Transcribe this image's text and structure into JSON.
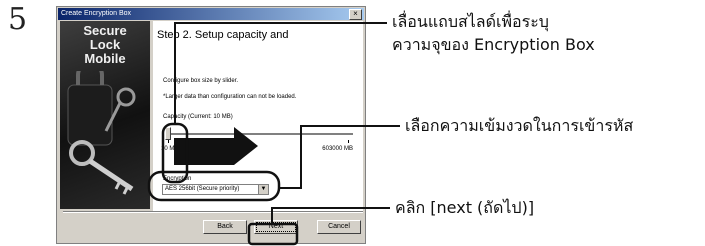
{
  "step_number": "5",
  "dialog": {
    "title": "Create Encryption Box",
    "close_glyph": "×",
    "brand": "Secure Lock Mobile",
    "brand_lines": [
      "Secure",
      "Lock",
      "Mobile"
    ],
    "step_title": "Step 2. Setup capacity and",
    "configure_text": "Configure box size by slider.",
    "warning_text": "*Larger data than configuration can not be loaded.",
    "capacity_label": "Capacity (Current: 10 MB)",
    "slider": {
      "min_label": "10 MB",
      "max_label": "603000 MB",
      "value_mb": 10,
      "min_mb": 10,
      "max_mb": 603000
    },
    "encryption_label": "Encryption",
    "encryption_value": "AES 256bit (Secure priority)",
    "buttons": {
      "back": "Back",
      "next": "Next",
      "cancel": "Cancel"
    }
  },
  "callouts": {
    "slider_line1": "เลื่อนแถบสไลด์เพื่อระบุ",
    "slider_line2": "ความจุของ Encryption Box",
    "encryption": "เลือกความเข้มงวดในการเข้ารหัส",
    "next": "คลิก [next (ถัดไป)]"
  },
  "colors": {
    "titlebar_start": "#0a246a",
    "titlebar_end": "#a6caf0",
    "dialog_bg": "#d4d0c8",
    "callout_line": "#000000"
  }
}
